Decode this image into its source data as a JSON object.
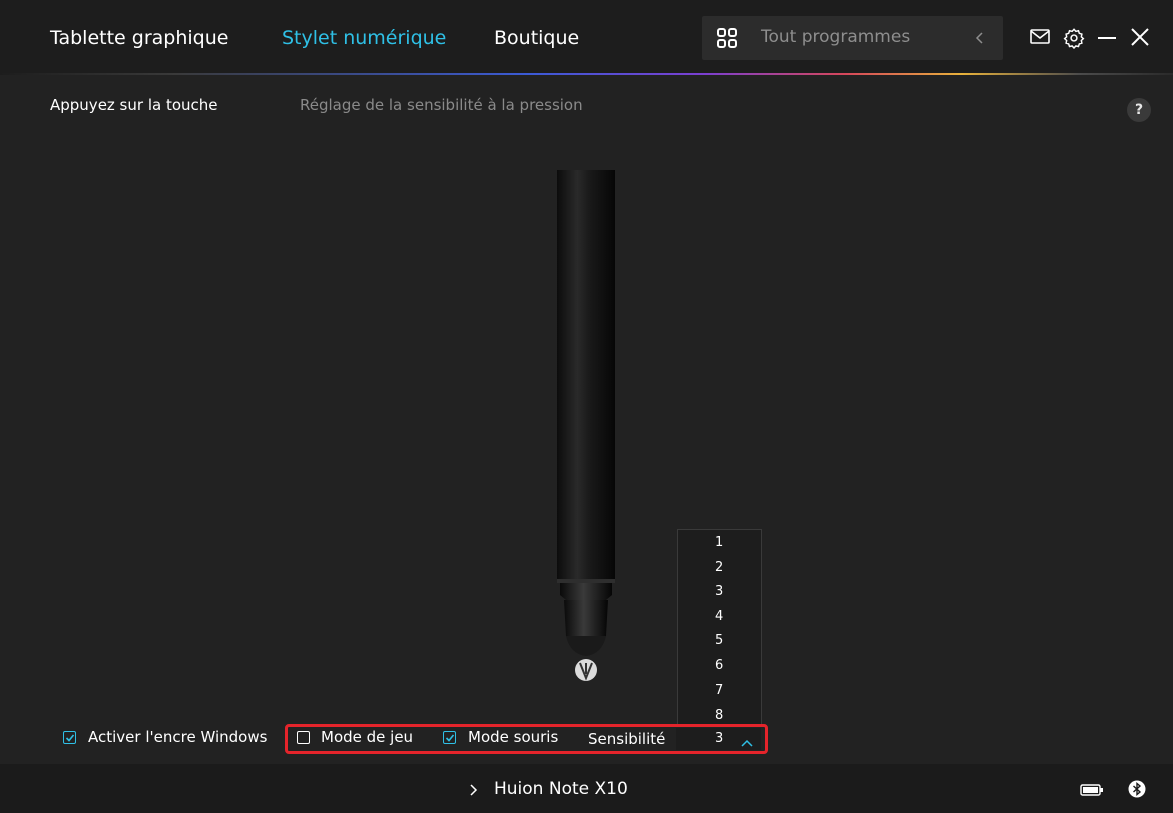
{
  "header": {
    "tabs": [
      {
        "label": "Tablette graphique",
        "active": false
      },
      {
        "label": "Stylet numérique",
        "active": true
      },
      {
        "label": "Boutique",
        "active": false
      }
    ],
    "search": {
      "icon": "grid-icon",
      "label": "Tout programmes"
    },
    "icons": [
      "chevron-left-icon",
      "mail-icon",
      "settings-icon",
      "minimize-icon",
      "close-icon"
    ],
    "accent_color": "#2fc0e6"
  },
  "subtabs": {
    "active": "Appuyez sur la touche",
    "inactive": "Réglage de la sensibilité à la pression",
    "help": "?"
  },
  "controls": {
    "windows_ink": {
      "label": "Activer l'encre Windows",
      "checked": true
    },
    "game_mode": {
      "label": "Mode de jeu",
      "checked": false
    },
    "mouse_mode": {
      "label": "Mode souris",
      "checked": true
    },
    "sensitivity": {
      "label": "Sensibilité",
      "value": "3"
    },
    "sensitivity_options": [
      "1",
      "2",
      "3",
      "4",
      "5",
      "6",
      "7",
      "8"
    ],
    "highlight_color": "#e5242b"
  },
  "footer": {
    "device_name": "Huion Note X10",
    "icons": [
      "chevron-right-icon",
      "battery-icon",
      "bluetooth-icon"
    ]
  }
}
